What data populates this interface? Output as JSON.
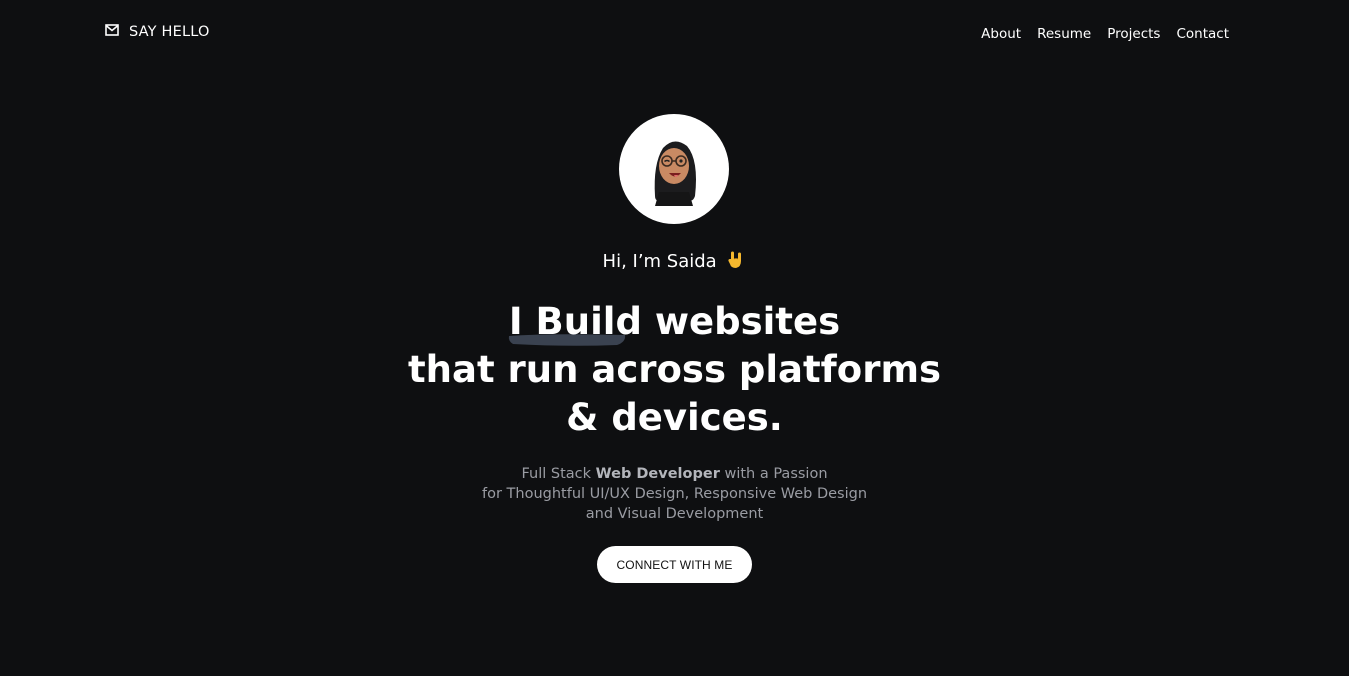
{
  "header": {
    "say_hello": "SAY HELLO",
    "say_hello_icon": "mail-icon",
    "nav": [
      {
        "label": "About"
      },
      {
        "label": "Resume"
      },
      {
        "label": "Projects"
      },
      {
        "label": "Contact"
      }
    ]
  },
  "hero": {
    "avatar_icon": "memoji-avatar",
    "greeting": "Hi, I’m Saida",
    "greeting_icon": "rock-on-hand-emoji",
    "headline": {
      "highlight": "I Build",
      "line1_rest": " websites",
      "line2": "that run across platforms",
      "line3": "& devices."
    },
    "subtitle": {
      "part1": "Full Stack ",
      "bold": "Web Developer",
      "part2": " with a Passion",
      "line2": "for Thoughtful UI/UX Design, Responsive Web Design",
      "line3": "and Visual Development"
    },
    "cta_label": "CONNECT WITH ME"
  },
  "colors": {
    "background": "#0e0f11",
    "text": "#ffffff",
    "muted": "#9a9ca3",
    "button_bg": "#ffffff",
    "button_text": "#111111"
  }
}
